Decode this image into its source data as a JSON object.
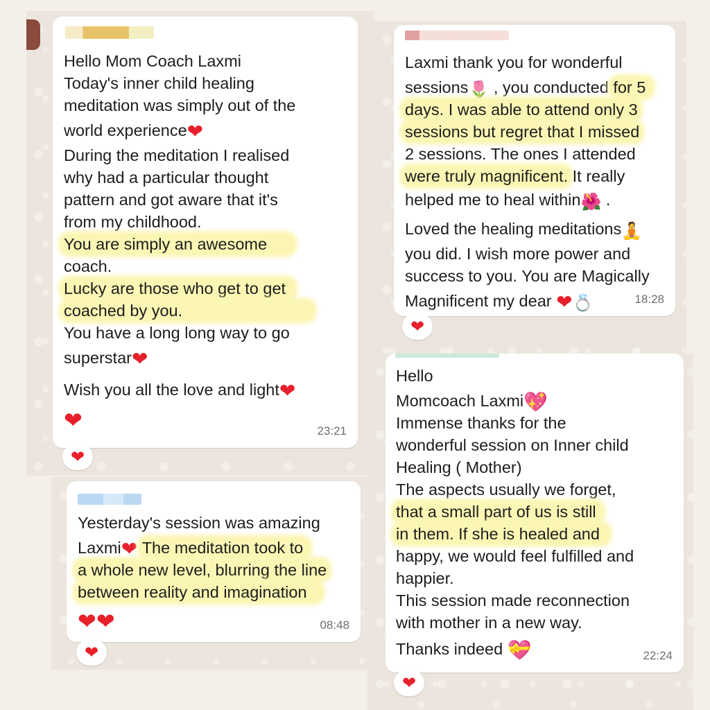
{
  "colors": {
    "heart": "#e8202a",
    "highlight": "#fbf6b4",
    "bubble": "#ffffff",
    "chat_bg": "#ece5dd",
    "timestamp": "#6d6d6d"
  },
  "message1": {
    "lines": [
      "Hello Mom Coach Laxmi",
      "Today's inner child healing",
      "meditation was simply out of the",
      "world experience",
      "During the meditation I realised",
      "why had a particular thought",
      "pattern and got aware that it's",
      "from my childhood.",
      "You are simply an awesome",
      "coach.",
      "Lucky are those who get to get",
      "coached by you.",
      "You have a long long way to go",
      "superstar",
      "Wish you all the love and light"
    ],
    "time": "23:21",
    "reaction_icon": "red-heart-icon"
  },
  "message2": {
    "lines": [
      "Laxmi thank you for wonderful",
      "sessions",
      " , you conducted ",
      "for 5",
      "days. I was able to attend only 3",
      "sessions but regret that I missed",
      "2 sessions. The ones I attended",
      "were truly magnificent.",
      " It really",
      "helped me to heal within",
      " .",
      "Loved the healing meditations",
      "you did. I wish more power and",
      "success to you. You are Magically",
      "Magnificent my dear"
    ],
    "time": "18:28",
    "icons": [
      "tulip-icon",
      "hibiscus-icon",
      "meditating-person-icon",
      "red-heart-icon",
      "ring-icon"
    ],
    "reaction_icon": "red-heart-icon"
  },
  "message3": {
    "lines": [
      "Yesterday's session was amazing",
      "Laxmi",
      " The meditation took to",
      "a whole new level, blurring the line",
      "between reality and imagination"
    ],
    "time": "08:48",
    "reaction_icon": "red-heart-icon"
  },
  "message4": {
    "lines": [
      "Hello",
      "Momcoach Laxmi",
      "Immense thanks for the",
      "wonderful session on Inner child",
      "Healing ( Mother)",
      "The aspects usually we forget,",
      "that a small part of us is still",
      "in them. If she is healed and",
      "happy, we would feel fulfilled and",
      "happier.",
      "This session made reconnection",
      "with mother in a new way.",
      "Thanks indeed"
    ],
    "time": "22:24",
    "icons": [
      "sparkling-heart-icon",
      "heart-with-ribbon-icon"
    ],
    "reaction_icon": "red-heart-icon"
  }
}
